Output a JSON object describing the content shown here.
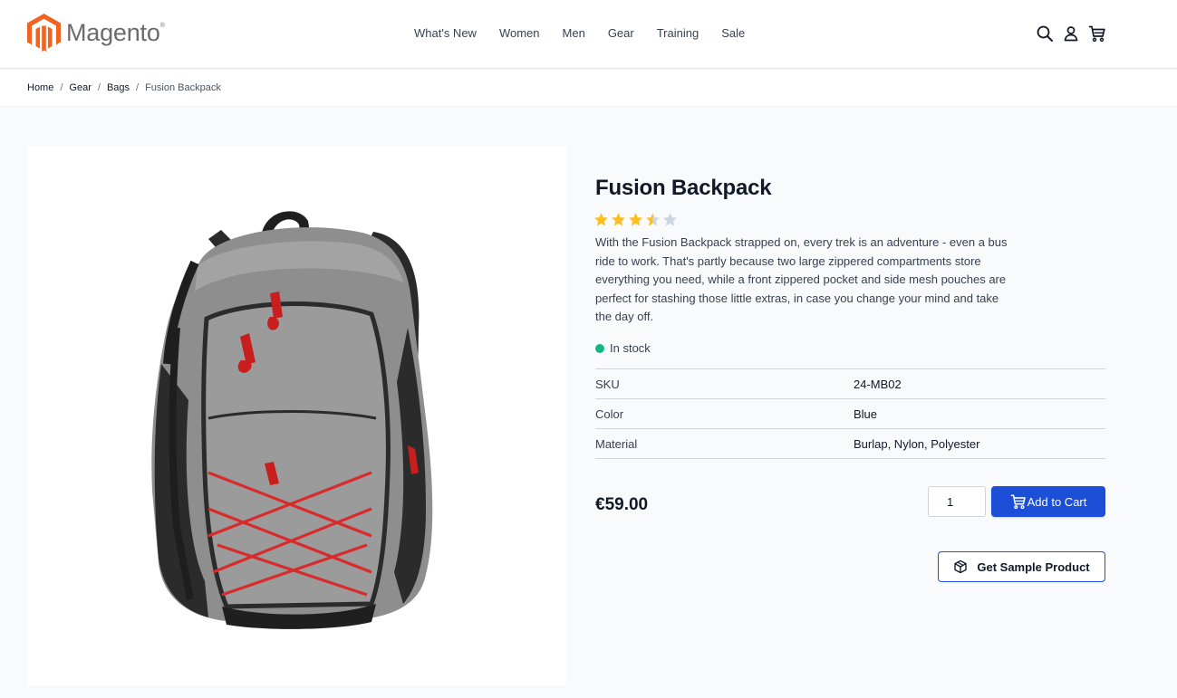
{
  "header": {
    "logo_text": "Magento",
    "logo_reg": "®",
    "nav": [
      "What's New",
      "Women",
      "Men",
      "Gear",
      "Training",
      "Sale"
    ],
    "icons": [
      "search-icon",
      "account-icon",
      "cart-icon"
    ]
  },
  "breadcrumb": {
    "items": [
      "Home",
      "Gear",
      "Bags"
    ],
    "separator": "/",
    "current": "Fusion Backpack"
  },
  "product": {
    "title": "Fusion Backpack",
    "rating": 3.5,
    "rating_max": 5,
    "description": "With the Fusion Backpack strapped on, every trek is an adventure - even a bus ride to work. That's partly because two large zippered compartments store everything you need, while a front zippered pocket and side mesh pouches are perfect for stashing those little extras, in case you change your mind and take the day off.",
    "stock": "In stock",
    "attributes": [
      {
        "label": "SKU",
        "value": "24-MB02"
      },
      {
        "label": "Color",
        "value": "Blue"
      },
      {
        "label": "Material",
        "value": "Burlap, Nylon, Polyester"
      }
    ],
    "price": "€59.00",
    "qty": "1",
    "add_to_cart_label": "Add to Cart",
    "sample_label": "Get Sample Product",
    "image": "backpack-image"
  },
  "colors": {
    "accent": "#1d4ed8",
    "logo": "#f26322",
    "star": "#fbbf24",
    "star_empty": "#cbd5e1",
    "stock": "#10b981"
  }
}
